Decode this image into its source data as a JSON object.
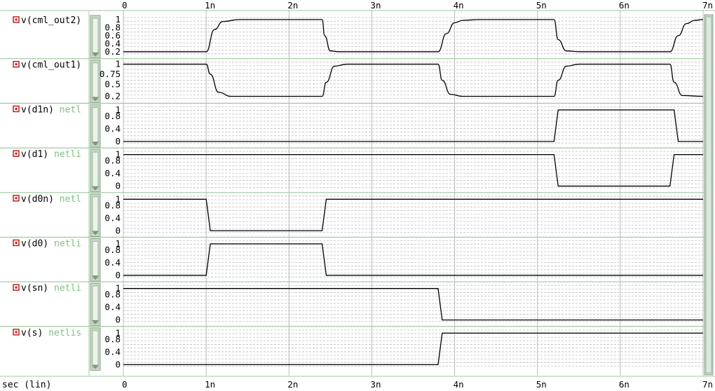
{
  "colors": {
    "background": "#ffffff",
    "grid": "#bdbdbd",
    "trace": "#000000",
    "panel_divider": "#9fc89f",
    "scroll_track": "#c6d6c6",
    "signal_icon": "#c02020",
    "netlist_text": "#7fbf7f"
  },
  "x_axis": {
    "unit_label": "sec (lin)",
    "tick_labels": [
      "0",
      "1n",
      "2n",
      "3n",
      "4n",
      "5n",
      "6n",
      "7n"
    ]
  },
  "signals": [
    {
      "name": "v(cml_out2)",
      "source": "",
      "y_labels": [
        "1",
        "0.8",
        "0.6",
        "0.4",
        "0.2"
      ]
    },
    {
      "name": "v(cml_out1)",
      "source": "",
      "y_labels": [
        "1",
        "0.75",
        "0.5",
        "0.2"
      ]
    },
    {
      "name": "v(d1n)",
      "source": "netl",
      "y_labels": [
        "1",
        "0.8",
        "0.4",
        "0"
      ]
    },
    {
      "name": "v(d1)",
      "source": "netli",
      "y_labels": [
        "1",
        "0.8",
        "0.4",
        "0"
      ]
    },
    {
      "name": "v(d0n)",
      "source": "netl",
      "y_labels": [
        "1",
        "0.8",
        "0.4",
        "0"
      ]
    },
    {
      "name": "v(d0)",
      "source": "netli",
      "y_labels": [
        "1",
        "0.8",
        "0.4",
        "0"
      ]
    },
    {
      "name": "v(sn)",
      "source": "netli",
      "y_labels": [
        "1",
        "0.8",
        "0.4",
        "0"
      ]
    },
    {
      "name": "v(s)",
      "source": "netlis",
      "y_labels": [
        "1",
        "0.8",
        "0.4",
        "0"
      ]
    }
  ],
  "chart_data": {
    "type": "line",
    "xlim": [
      0,
      7
    ],
    "x_unit": "ns",
    "series": [
      {
        "name": "v(cml_out2)",
        "ylim": [
          0.15,
          1.05
        ],
        "style": "smooth",
        "x": [
          0,
          1.0,
          1.1,
          1.2,
          1.4,
          2.4,
          2.43,
          2.5,
          2.6,
          3.8,
          3.9,
          4.0,
          4.1,
          4.3,
          5.2,
          5.25,
          5.35,
          5.5,
          6.6,
          6.7,
          6.8,
          6.9,
          7.0
        ],
        "values": [
          0.2,
          0.2,
          0.75,
          0.95,
          1.0,
          1.0,
          0.6,
          0.22,
          0.2,
          0.2,
          0.65,
          0.92,
          0.98,
          1.0,
          1.0,
          0.5,
          0.22,
          0.2,
          0.2,
          0.6,
          0.9,
          0.98,
          1.0
        ]
      },
      {
        "name": "v(cml_out1)",
        "ylim": [
          0.15,
          1.05
        ],
        "style": "smooth",
        "x": [
          0,
          1.0,
          1.05,
          1.15,
          1.3,
          2.4,
          2.45,
          2.55,
          2.7,
          3.8,
          3.85,
          3.95,
          4.1,
          5.2,
          5.25,
          5.35,
          5.5,
          6.6,
          6.65,
          6.75,
          7.0
        ],
        "values": [
          1.0,
          1.0,
          0.75,
          0.3,
          0.2,
          0.2,
          0.55,
          0.95,
          1.0,
          1.0,
          0.6,
          0.25,
          0.2,
          0.2,
          0.6,
          0.95,
          1.0,
          1.0,
          0.55,
          0.22,
          0.2
        ]
      },
      {
        "name": "v(d1n)",
        "ylim": [
          -0.05,
          1.1
        ],
        "x": [
          0,
          5.2,
          5.25,
          6.65,
          6.7,
          7.0
        ],
        "values": [
          0,
          0,
          1,
          1,
          0,
          0
        ]
      },
      {
        "name": "v(d1)",
        "ylim": [
          -0.05,
          1.1
        ],
        "x": [
          0,
          5.2,
          5.25,
          6.6,
          6.65,
          7.0
        ],
        "values": [
          1,
          1,
          0,
          0,
          1,
          1
        ]
      },
      {
        "name": "v(d0n)",
        "ylim": [
          -0.05,
          1.1
        ],
        "x": [
          0,
          1.0,
          1.05,
          2.4,
          2.45,
          7.0
        ],
        "values": [
          1,
          1,
          0,
          0,
          1,
          1
        ]
      },
      {
        "name": "v(d0)",
        "ylim": [
          -0.05,
          1.1
        ],
        "x": [
          0,
          1.0,
          1.05,
          2.4,
          2.45,
          7.0
        ],
        "values": [
          0,
          0,
          1,
          1,
          0,
          0
        ]
      },
      {
        "name": "v(sn)",
        "ylim": [
          -0.05,
          1.1
        ],
        "x": [
          0,
          3.8,
          3.85,
          7.0
        ],
        "values": [
          1,
          1,
          0,
          0
        ]
      },
      {
        "name": "v(s)",
        "ylim": [
          -0.05,
          1.1
        ],
        "x": [
          0,
          3.8,
          3.85,
          7.0
        ],
        "values": [
          0,
          0,
          1,
          1
        ]
      }
    ]
  }
}
